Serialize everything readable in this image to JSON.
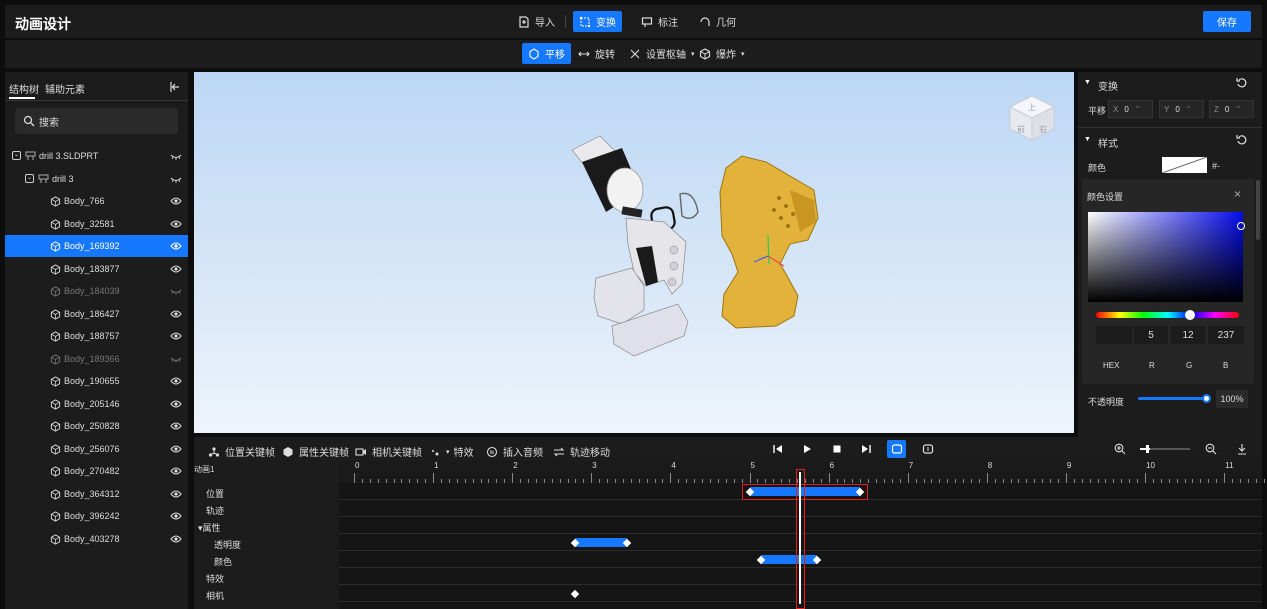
{
  "app": {
    "title": "动画设计",
    "save_label": "保存"
  },
  "toolbar": {
    "import": "导入",
    "transform": "变换",
    "annotate": "标注",
    "geometry": "几何"
  },
  "subtoolbar": {
    "translate": "平移",
    "rotate": "旋转",
    "set_axis": "设置枢轴",
    "explode": "爆炸"
  },
  "left_panel": {
    "tabs": [
      "结构树",
      "辅助元素"
    ],
    "search_placeholder": "搜索",
    "tree": [
      {
        "label": "drill 3.SLDPRT",
        "visible": false
      },
      {
        "label": "drill 3",
        "visible": false
      },
      {
        "label": "Body_766",
        "visible": true
      },
      {
        "label": "Body_32581",
        "visible": true
      },
      {
        "label": "Body_169392",
        "visible": true,
        "selected": true
      },
      {
        "label": "Body_183877",
        "visible": true
      },
      {
        "label": "Body_184039",
        "visible": false
      },
      {
        "label": "Body_186427",
        "visible": true
      },
      {
        "label": "Body_188757",
        "visible": true
      },
      {
        "label": "Body_189366",
        "visible": false
      },
      {
        "label": "Body_190655",
        "visible": true
      },
      {
        "label": "Body_205146",
        "visible": true
      },
      {
        "label": "Body_250828",
        "visible": true
      },
      {
        "label": "Body_256076",
        "visible": true
      },
      {
        "label": "Body_270482",
        "visible": true
      },
      {
        "label": "Body_364312",
        "visible": true
      },
      {
        "label": "Body_396242",
        "visible": true
      },
      {
        "label": "Body_403278",
        "visible": true
      }
    ]
  },
  "viewcube": {
    "top": "上",
    "front": "前",
    "right": "右"
  },
  "right_panel": {
    "transform_title": "变换",
    "translate_label": "平移",
    "x_label": "X",
    "x_value": "0",
    "y_label": "Y",
    "y_value": "0",
    "z_label": "Z",
    "z_value": "0",
    "style_title": "样式",
    "color_label": "颜色",
    "color_hex_text": "#-",
    "color_settings_title": "颜色设置",
    "r_value": "5",
    "g_value": "12",
    "b_value": "237",
    "hex_label": "HEX",
    "r_label": "R",
    "g_label": "G",
    "b_label": "B",
    "opacity_label": "不透明度",
    "opacity_value": "100%",
    "picked_color": "#050ced"
  },
  "timeline": {
    "tools": {
      "position_key": "位置关键帧",
      "property_key": "属性关键帧",
      "camera_key": "相机关键帧",
      "effects": "特效",
      "insert_audio": "插入音频",
      "path_move": "轨迹移动"
    },
    "animation_name": "动画1",
    "tracks": [
      "位置",
      "轨迹",
      "▾属性",
      "透明度",
      "颜色",
      "特效",
      "相机"
    ],
    "ruler_numbers": [
      "0",
      "1",
      "2",
      "3",
      "4",
      "5",
      "6",
      "7",
      "8",
      "9",
      "10",
      "11"
    ],
    "playhead_time": 5.65,
    "keyframe_segments": [
      {
        "track": "位置",
        "start": 5.0,
        "end": 6.4
      },
      {
        "track": "透明度",
        "start": 2.8,
        "end": 3.45
      },
      {
        "track": "颜色",
        "start": 5.15,
        "end": 5.85
      }
    ],
    "single_keys": [
      {
        "track": "相机",
        "time": 2.8
      }
    ]
  }
}
